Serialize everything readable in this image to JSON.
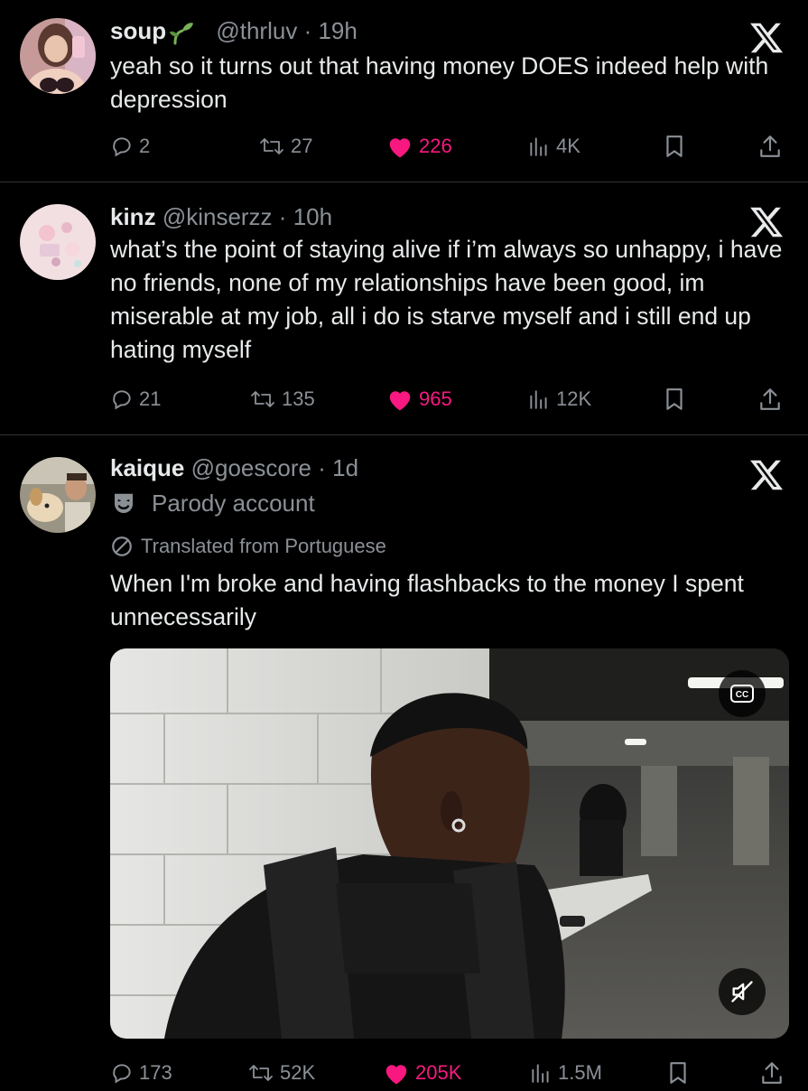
{
  "tweets": [
    {
      "display_name": "soup",
      "handle": "@thrluv",
      "separator": "·",
      "time": "19h",
      "text": "yeah so it turns out that having money DOES indeed help with depression",
      "replies": "2",
      "reposts": "27",
      "likes": "226",
      "views": "4K"
    },
    {
      "display_name": "kinz",
      "handle": "@kinserzz",
      "separator": "·",
      "time": "10h",
      "text": "what’s the point of staying alive if i’m always so unhappy, i have no friends, none of my relationships have been good, im miserable at my job, all i do is starve myself and i still end up hating myself",
      "replies": "21",
      "reposts": "135",
      "likes": "965",
      "views": "12K"
    },
    {
      "display_name": "kaique",
      "handle": "@goescore",
      "separator": "·",
      "time": "1d",
      "parody_label": "Parody account",
      "translated_label": "Translated from Portuguese",
      "text": "When I'm broke and having flashbacks to the money I spent unnecessarily",
      "replies": "173",
      "reposts": "52K",
      "likes": "205K",
      "views": "1.5M"
    }
  ],
  "icons": {
    "platform_logo": "x-logo-icon",
    "reply": "reply-icon",
    "repost": "repost-icon",
    "like": "heart-icon",
    "views": "views-icon",
    "bookmark": "bookmark-icon",
    "share": "share-icon",
    "captions": "cc-icon",
    "mute": "muted-speaker-icon",
    "parody": "mask-icon",
    "translate": "translate-icon",
    "sprout": "sprout-emoji"
  },
  "colors": {
    "background": "#000000",
    "text": "#e7e9ea",
    "secondary_text": "#8b9096",
    "like_pink": "#f91880",
    "divider": "#2f3336"
  }
}
